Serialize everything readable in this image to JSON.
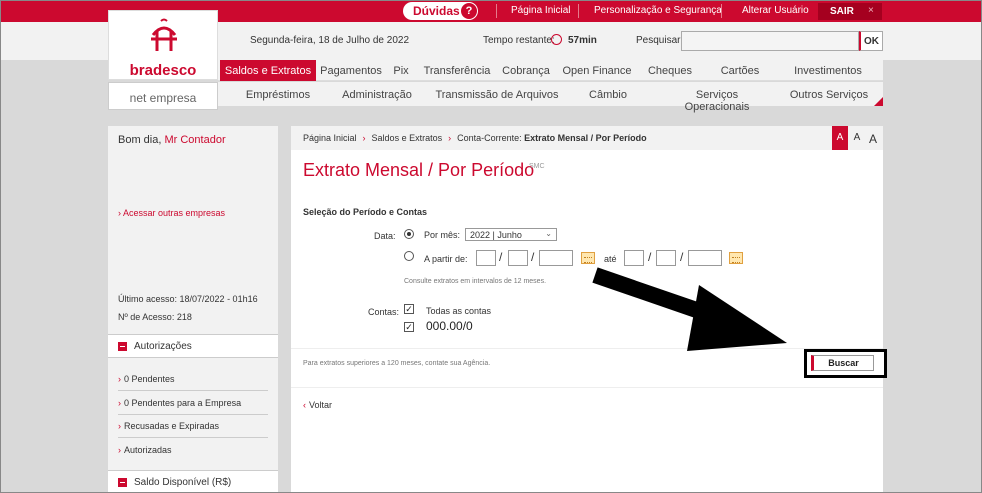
{
  "topbar": {
    "duvidas_label": "Dúvidas",
    "help_icon": "?",
    "links": [
      "Página Inicial",
      "Personalização e Segurança",
      "Alterar Usuário"
    ],
    "sair_label": "SAIR",
    "close_icon": "×"
  },
  "brand": {
    "logo_text": "bradesco",
    "subtitle": "net empresa",
    "accent": "#cc092f"
  },
  "header": {
    "date": "Segunda-feira, 18 de Julho de 2022",
    "tempo_label": "Tempo restante:",
    "tempo_value": "57min",
    "search_label": "Pesquisar:",
    "search_value": "",
    "ok_label": "OK"
  },
  "nav1": [
    "Saldos e Extratos",
    "Pagamentos",
    "Pix",
    "Transferência",
    "Cobrança",
    "Open Finance",
    "Cheques",
    "Cartões",
    "Investimentos"
  ],
  "nav2": [
    "Empréstimos",
    "Administração",
    "Transmissão de Arquivos",
    "Câmbio",
    "Serviços Operacionais",
    "Outros Serviços"
  ],
  "sidebar": {
    "greeting": "Bom dia,",
    "user": "Mr Contador",
    "other_companies": "Acessar outras empresas",
    "last_access": "Último acesso: 18/07/2022 - 01h16",
    "access_no": "Nº de Acesso: 218",
    "autorizacoes_title": "Autorizações",
    "autorizacoes": [
      "0 Pendentes",
      "0 Pendentes para a Empresa",
      "Recusadas e Expiradas",
      "Autorizadas"
    ],
    "saldo_title": "Saldo Disponível (R$)"
  },
  "breadcrumb": {
    "items": [
      "Página Inicial",
      "Saldos e Extratos",
      "Conta-Corrente:"
    ],
    "current": "Extrato Mensal / Por Período",
    "font_sizes": [
      "A",
      "A",
      "A"
    ]
  },
  "page": {
    "title": "Extrato Mensal / Por Período",
    "badge": "SMC",
    "section": "Seleção do Período e Contas",
    "data_label": "Data:",
    "por_mes": "Por mês:",
    "month_value": "2022 | Junho",
    "a_partir": "A partir de:",
    "ate": "até",
    "slash": "/",
    "hint": "Consulte extratos em intervalos de 12 meses.",
    "contas_label": "Contas:",
    "todas_contas": "Todas as contas",
    "conta": "000.00/0",
    "check_mark": "✓",
    "footer_note": "Para extratos superiores a 120 meses, contate sua Agência.",
    "buscar": "Buscar",
    "voltar": "Voltar"
  }
}
